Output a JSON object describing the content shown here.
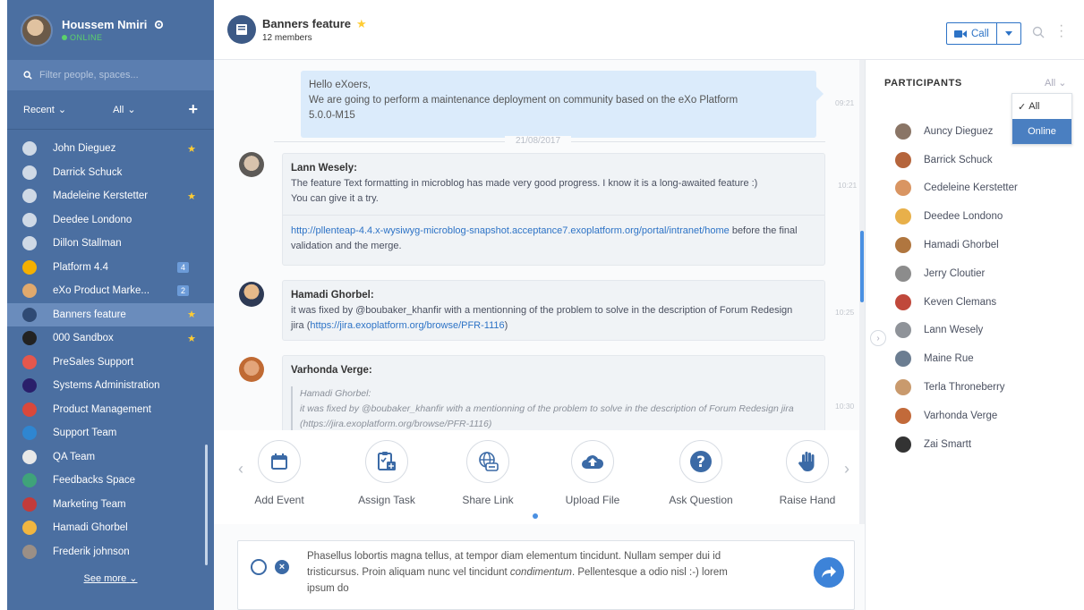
{
  "user": {
    "name": "Houssem Nmiri",
    "status": "ONLINE"
  },
  "sidebar": {
    "search_placeholder": "Filter people, spaces...",
    "filter_recent": "Recent",
    "filter_all": "All",
    "add": "+",
    "see_more": "See more",
    "items": [
      {
        "label": "John Dieguez",
        "badge": "",
        "star": true,
        "icon_color": "#cfd9e6",
        "active": false
      },
      {
        "label": "Darrick Schuck",
        "badge": "",
        "star": false,
        "icon_color": "#cfd9e6",
        "active": false
      },
      {
        "label": "Madeleine Kerstetter",
        "badge": "",
        "star": true,
        "icon_color": "#cfd9e6",
        "active": false
      },
      {
        "label": "Deedee Londono",
        "badge": "",
        "star": false,
        "icon_color": "#cfd9e6",
        "active": false
      },
      {
        "label": "Dillon Stallman",
        "badge": "",
        "star": false,
        "icon_color": "#cfd9e6",
        "active": false
      },
      {
        "label": "Platform 4.4",
        "badge": "4",
        "star": false,
        "icon_color": "#f5b000",
        "active": false
      },
      {
        "label": "eXo Product Marke...",
        "badge": "2",
        "star": false,
        "icon_color": "#e0a96d",
        "active": false
      },
      {
        "label": "Banners feature",
        "badge": "",
        "star": true,
        "icon_color": "#2f4a74",
        "active": true
      },
      {
        "label": "000 Sandbox",
        "badge": "",
        "star": true,
        "icon_color": "#222222",
        "active": false
      },
      {
        "label": "PreSales Support",
        "badge": "",
        "star": false,
        "icon_color": "#e4574d",
        "active": false
      },
      {
        "label": "Systems Administration",
        "badge": "",
        "star": false,
        "icon_color": "#2a1f6b",
        "active": false
      },
      {
        "label": "Product Management",
        "badge": "",
        "star": false,
        "icon_color": "#d9483b",
        "active": false
      },
      {
        "label": "Support Team",
        "badge": "",
        "star": false,
        "icon_color": "#2f86d1",
        "active": false
      },
      {
        "label": "QA Team",
        "badge": "",
        "star": false,
        "icon_color": "#e8e8e8",
        "active": false
      },
      {
        "label": "Feedbacks Space",
        "badge": "",
        "star": false,
        "icon_color": "#3fa37a",
        "active": false
      },
      {
        "label": "Marketing Team",
        "badge": "",
        "star": false,
        "icon_color": "#c23b3b",
        "active": false
      },
      {
        "label": "Hamadi Ghorbel",
        "badge": "",
        "star": false,
        "icon_color": "#f2b640",
        "active": false
      },
      {
        "label": "Frederik johnson",
        "badge": "",
        "star": false,
        "icon_color": "#9b8f86",
        "active": false
      }
    ]
  },
  "room": {
    "name": "Banners feature",
    "members": "12 members",
    "call_label": "Call"
  },
  "messages": {
    "self": {
      "line1": "Hello eXoers,",
      "line2": "We are going to perform a maintenance deployment on community based on the eXo Platform",
      "line3": "5.0.0-M15",
      "time": "09:21"
    },
    "date_separator": "21/08/2017",
    "m1": {
      "author": "Lann Wesely:",
      "line1": "The feature Text formatting in microblog has made very good progress. I know it is a long-awaited feature :)",
      "line2": "You can give it a try.",
      "time": "10:21",
      "link": "http://pllenteap-4.4.x-wysiwyg-microblog-snapshot.acceptance7.exoplatform.org/portal/intranet/home",
      "link_after": " before the final",
      "line4": "validation and the merge."
    },
    "m2": {
      "author": "Hamadi Ghorbel:",
      "line1": "it was fixed by @boubaker_khanfir with a mentionning of the problem to solve in the description of Forum Redesign",
      "line2_pre": "jira (",
      "link": "https://jira.exoplatform.org/browse/PFR-1116",
      "line2_post": ")",
      "time": "10:25"
    },
    "m3": {
      "author": "Varhonda Verge:",
      "quote_author": "Hamadi Ghorbel:",
      "quote_line1": "it was fixed by @boubaker_khanfir with a mentionning of the problem to solve in the description of Forum Redesign jira",
      "quote_line2": "(https://jira.exoplatform.org/browse/PFR-1116)",
      "time": "10:30"
    }
  },
  "actions": [
    {
      "label": "Add Event",
      "icon": "calendar-icon"
    },
    {
      "label": "Assign Task",
      "icon": "task-icon"
    },
    {
      "label": "Share Link",
      "icon": "link-globe-icon"
    },
    {
      "label": "Upload File",
      "icon": "cloud-upload-icon"
    },
    {
      "label": "Ask Question",
      "icon": "question-icon"
    },
    {
      "label": "Raise Hand",
      "icon": "hand-icon"
    }
  ],
  "composer": {
    "line1": "Phasellus lobortis magna tellus, at tempor diam elementum tincidunt. Nullam semper dui id",
    "line2_pre": "tristicursus. Proin aliquam nunc vel tincidunt ",
    "line2_italic": "condimentum",
    "line2_post": ". Pellentesque a odio nisl :-) lorem",
    "line3": "ipsum do"
  },
  "participants": {
    "title": "PARTICIPANTS",
    "filter": "All",
    "filter_options": [
      "All",
      "Online"
    ],
    "items": [
      {
        "name": "Auncy Dieguez",
        "color": "#8a7566"
      },
      {
        "name": "Barrick Schuck",
        "color": "#b5653c"
      },
      {
        "name": "Cedeleine Kerstetter",
        "color": "#d99562"
      },
      {
        "name": "Deedee Londono",
        "color": "#e8b04a"
      },
      {
        "name": "Hamadi Ghorbel",
        "color": "#b0763f"
      },
      {
        "name": "Jerry Cloutier",
        "color": "#8c8c8c"
      },
      {
        "name": "Keven Clemans",
        "color": "#c0483b"
      },
      {
        "name": "Lann Wesely",
        "color": "#8f9399"
      },
      {
        "name": "Maine Rue",
        "color": "#6b7d91"
      },
      {
        "name": "Terla Throneberry",
        "color": "#c99a6d"
      },
      {
        "name": "Varhonda Verge",
        "color": "#c26a3a"
      },
      {
        "name": "Zai Smartt",
        "color": "#333333"
      }
    ]
  },
  "colors": {
    "sidebar": "#4b6fa1",
    "accent": "#2d73c6",
    "star": "#ffcc33"
  }
}
